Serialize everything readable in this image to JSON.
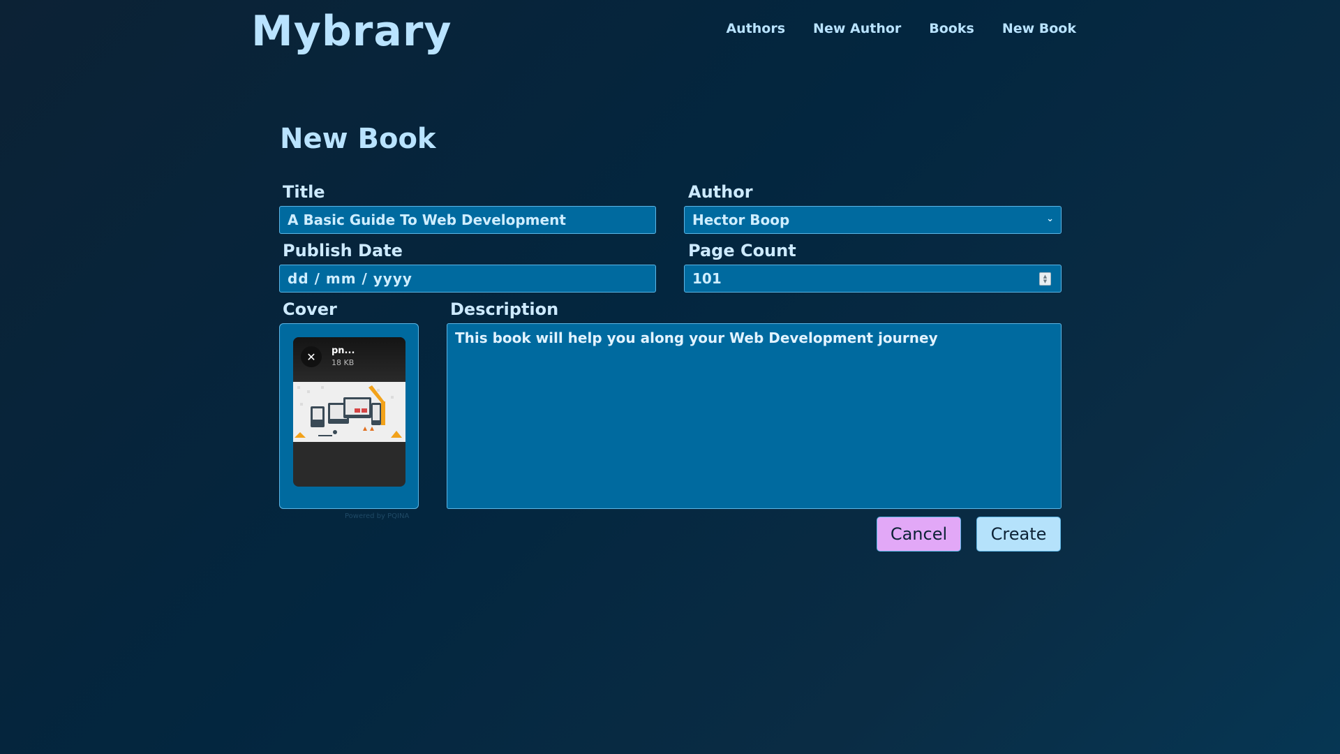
{
  "header": {
    "logo": "Mybrary",
    "nav": [
      "Authors",
      "New Author",
      "Books",
      "New Book"
    ]
  },
  "form": {
    "page_title": "New Book",
    "title_label": "Title",
    "title_value": "A Basic Guide To Web Development",
    "author_label": "Author",
    "author_value": "Hector Boop",
    "publish_date_label": "Publish Date",
    "publish_date_placeholder": "dd / mm / yyyy",
    "page_count_label": "Page Count",
    "page_count_value": "101",
    "cover_label": "Cover",
    "cover_file_name": "pn...",
    "cover_file_size": "18 KB",
    "powered_by": "Powered by PQINA",
    "description_label": "Description",
    "description_value": "This book will help you along your Web Development journey",
    "cancel_label": "Cancel",
    "create_label": "Create"
  },
  "colors": {
    "background": "#03263f",
    "field": "#006a9f",
    "text": "#b9e3ff",
    "cancel": "#e2a8f7",
    "create": "#b5e2fb"
  },
  "icons": {
    "remove": "close-icon",
    "select": "chevron-down-icon",
    "spinner": "number-spinner-icon"
  }
}
